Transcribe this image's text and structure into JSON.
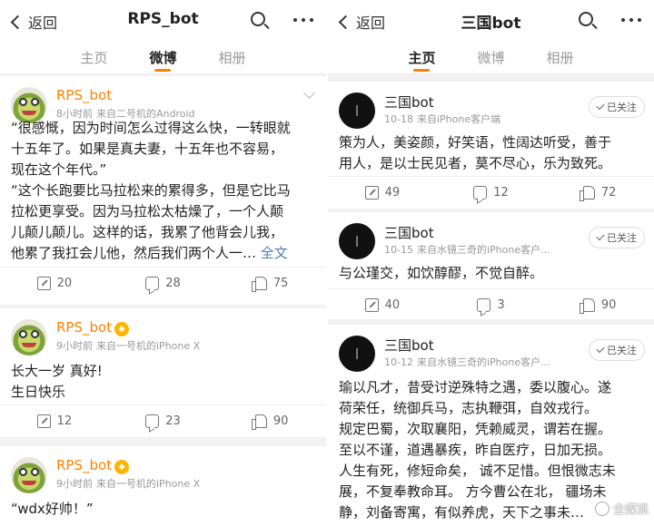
{
  "left": {
    "nav": {
      "back_label": "返回",
      "title": "RPS_bot"
    },
    "tabs": [
      "主页",
      "微博",
      "相册"
    ],
    "active_tab": "微博",
    "posts": [
      {
        "username": "RPS_bot",
        "time": "8小时前",
        "source": "来自二号机的Android",
        "lines": [
          "“很感慨，因为时间怎么过得这么快，一转眼就",
          "十五年了。如果是真夫妻，十五年也不容易，",
          "现在这个年代。”",
          "“这个长跑要比马拉松来的累得多，但是它比马",
          "拉松更享受。因为马拉松太枯燥了，一个人颠",
          "儿颠儿颠儿。这样的话，我累了他背会儿我，",
          "他累了我扛会儿他，然后我们两个人一…"
        ],
        "more": "全文",
        "reposts": "20",
        "comments": "28",
        "likes": "75"
      },
      {
        "username": "RPS_bot",
        "time": "9小时前",
        "source": "来自一号机的iPhone X",
        "lines": [
          "长大一岁 真好!",
          "生日快乐"
        ],
        "reposts": "12",
        "comments": "23",
        "likes": "90"
      },
      {
        "username": "RPS_bot",
        "time": "9小时前",
        "source": "来自一号机的iPhone X",
        "lines": [
          "“wdx好帅！”"
        ]
      }
    ]
  },
  "right": {
    "nav": {
      "back_label": "返回",
      "title": "三国bot"
    },
    "tabs": [
      "主页",
      "微博",
      "相册"
    ],
    "active_tab": "主页",
    "follow_label": "已关注",
    "posts": [
      {
        "username": "三国bot",
        "time": "10-18",
        "source": "来自iPhone客户端",
        "lines": [
          "策为人，美姿颜，好笑语，性阔达听受，善于",
          "用人，是以士民见者，莫不尽心，乐为致死。"
        ],
        "reposts": "49",
        "comments": "12",
        "likes": "72"
      },
      {
        "username": "三国bot",
        "time": "10-15",
        "source": "来自水镜三奇的iPhone客户...",
        "lines": [
          "与公瑾交，如饮醇醪，不觉自醉。"
        ],
        "reposts": "40",
        "comments": "3",
        "likes": "90"
      },
      {
        "username": "三国bot",
        "time": "10-12",
        "source": "来自水镜三奇的iPhone客户...",
        "lines": [
          "瑜以凡才，昔受讨逆殊特之遇，委以腹心。遂",
          "荷荣任，统御兵马，志执鞭弭，自效戎行。",
          "规定巴蜀，次取襄阳，凭赖威灵，谓若在握。",
          "至以不谨，道遇暴疾，昨自医疗，日加无损。",
          "人生有死，修短命矣，  诚不足惜。但恨微志未",
          "展，不复奉教命耳。 方今曹公在北， 疆场未",
          "静，刘备寄寓，有似养虎，天下之事未…"
        ]
      }
    ]
  },
  "watermark": "全媒派",
  "colors": {
    "accent": "#ff8200",
    "link": "#4c7fb9",
    "meta": "#999999"
  }
}
